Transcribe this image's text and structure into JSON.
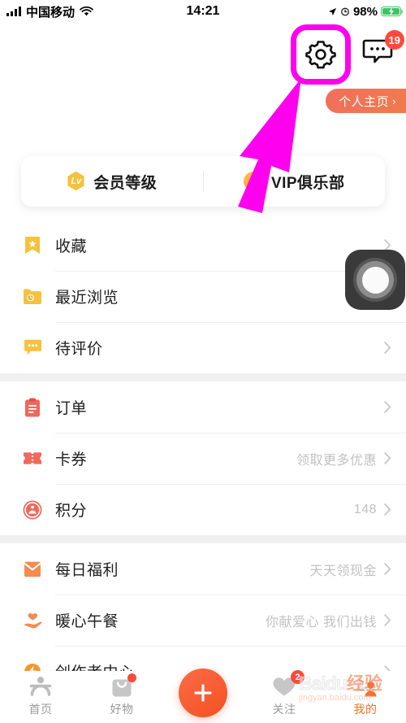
{
  "status_bar": {
    "carrier": "中国移动",
    "time": "14:21",
    "battery_percent": "98%",
    "signal_icon": "signal-bars-icon",
    "wifi_icon": "wifi-icon",
    "location_icon": "location-arrow-icon",
    "alarm_icon": "alarm-clock-icon",
    "battery_icon": "battery-charging-icon"
  },
  "header": {
    "settings_icon": "gear-icon",
    "messages_icon": "message-bubble-icon",
    "messages_badge": "19",
    "homepage_button": "个人主页",
    "homepage_chevron": "›",
    "highlight_color": "#ff00ef"
  },
  "member_card": {
    "left": {
      "badge_text": "Lv",
      "label": "会员等级",
      "badge_icon": "level-hexagon-icon"
    },
    "right": {
      "badge_text": "V",
      "label": "VIP俱乐部",
      "badge_icon": "vip-circle-icon"
    }
  },
  "sections": [
    {
      "rows": [
        {
          "icon": "bookmark-star-icon",
          "label": "收藏",
          "hint": "",
          "chevron": true
        },
        {
          "icon": "folder-clock-icon",
          "label": "最近浏览",
          "hint": "",
          "chevron": true
        },
        {
          "icon": "comment-dots-icon",
          "label": "待评价",
          "hint": "",
          "chevron": true
        }
      ]
    },
    {
      "rows": [
        {
          "icon": "clipboard-icon",
          "label": "订单",
          "hint": "",
          "chevron": true
        },
        {
          "icon": "ticket-icon",
          "label": "卡券",
          "hint": "领取更多优惠",
          "chevron": true
        },
        {
          "icon": "points-icon",
          "label": "积分",
          "hint": "148",
          "chevron": true
        }
      ]
    },
    {
      "rows": [
        {
          "icon": "red-envelope-icon",
          "label": "每日福利",
          "hint": "天天领现金",
          "chevron": true
        },
        {
          "icon": "heart-hand-icon",
          "label": "暖心午餐",
          "hint": "你献爱心 我们出钱",
          "chevron": true
        },
        {
          "icon": "lightning-icon",
          "label": "创作者中心",
          "hint": "",
          "chevron": true
        }
      ]
    }
  ],
  "tabbar": {
    "items": [
      {
        "label": "首页",
        "icon": "person-home-icon",
        "active": false,
        "badge": "",
        "dot": false
      },
      {
        "label": "好物",
        "icon": "shopping-bag-icon",
        "active": false,
        "badge": "",
        "dot": true
      },
      {
        "label": "",
        "icon": "plus-icon",
        "active": false,
        "badge": "",
        "dot": false
      },
      {
        "label": "关注",
        "icon": "heart-icon",
        "active": false,
        "badge": "2",
        "dot": false
      },
      {
        "label": "我的",
        "icon": "user-group-icon",
        "active": true,
        "badge": "",
        "dot": false
      }
    ],
    "active_color": "#f4712c"
  },
  "overlays": {
    "assistive_touch_icon": "assistive-touch-icon",
    "pointer_arrow_icon": "magenta-arrow-icon",
    "watermark_main": "Baidu",
    "watermark_cn": "经验",
    "watermark_sub": "jingyan.baidu.com"
  }
}
